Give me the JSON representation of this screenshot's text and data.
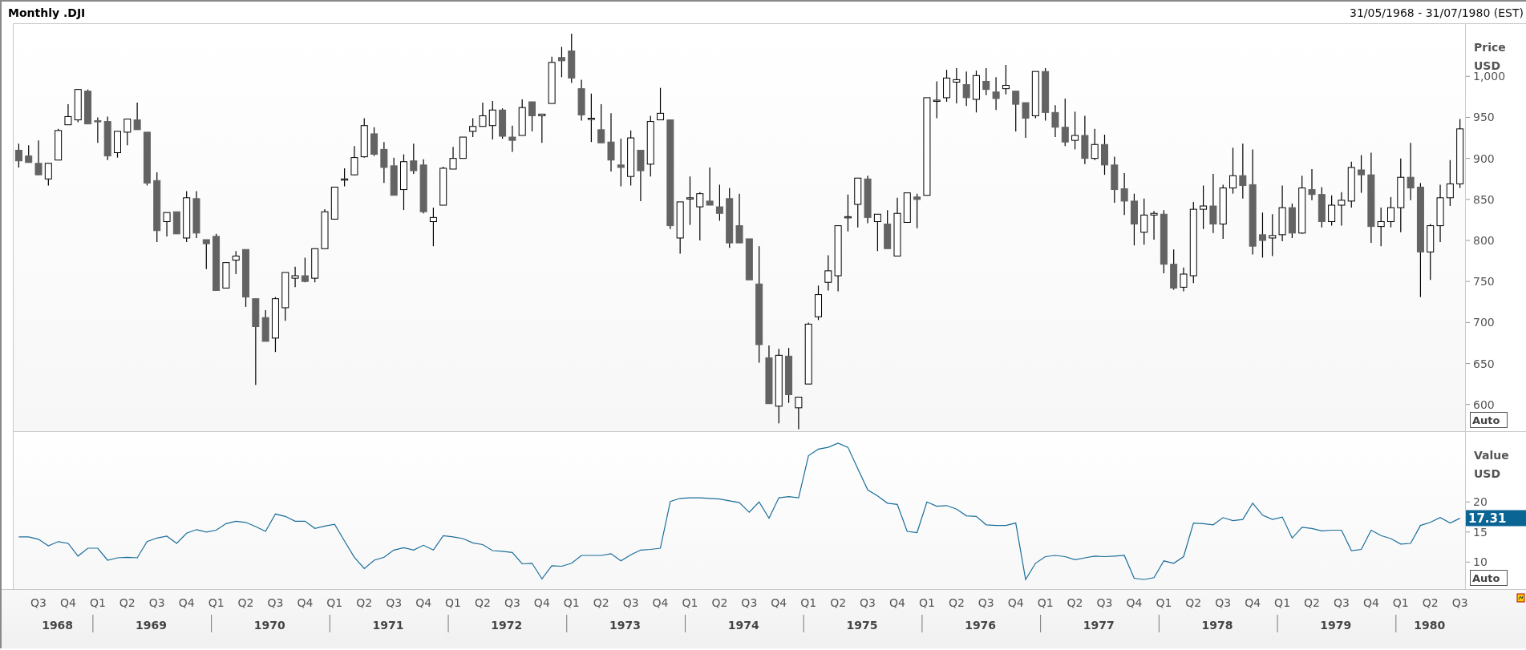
{
  "header": {
    "title": "Monthly .DJI",
    "date_range": "31/05/1968 - 31/07/1980 (EST)"
  },
  "price_panel": {
    "axis_title": "Price",
    "axis_unit": "USD",
    "scale_button": "Auto",
    "chart_data": {
      "type": "candlestick",
      "ylim": [
        567.5,
        1063.8
      ],
      "yticks": [
        {
          "value": 600,
          "label": "600"
        },
        {
          "value": 650,
          "label": "650"
        },
        {
          "value": 700,
          "label": "700"
        },
        {
          "value": 750,
          "label": "750"
        },
        {
          "value": 800,
          "label": "800"
        },
        {
          "value": 850,
          "label": "850"
        },
        {
          "value": 900,
          "label": "900"
        },
        {
          "value": 950,
          "label": "950"
        },
        {
          "value": 1000,
          "label": "1,000"
        }
      ],
      "ohlc": [
        [
          910,
          918,
          889,
          897
        ],
        [
          903,
          916,
          895,
          895
        ],
        [
          894,
          922,
          880,
          880
        ],
        [
          875,
          894,
          867,
          894
        ],
        [
          898,
          936,
          898,
          934
        ],
        [
          941,
          966,
          941,
          951
        ],
        [
          947,
          984,
          944,
          984
        ],
        [
          982,
          984,
          942,
          942
        ],
        [
          946,
          950,
          919,
          945
        ],
        [
          945,
          951,
          898,
          903
        ],
        [
          907,
          933,
          901,
          933
        ],
        [
          932,
          948,
          916,
          948
        ],
        [
          947,
          968,
          935,
          935
        ],
        [
          932,
          932,
          867,
          870
        ],
        [
          873,
          883,
          798,
          812
        ],
        [
          823,
          834,
          805,
          834
        ],
        [
          835,
          835,
          808,
          808
        ],
        [
          803,
          860,
          798,
          852
        ],
        [
          851,
          860,
          803,
          809
        ],
        [
          801,
          801,
          765,
          796
        ],
        [
          805,
          808,
          739,
          739
        ],
        [
          742,
          773,
          742,
          773
        ],
        [
          776,
          787,
          759,
          781
        ],
        [
          789,
          789,
          719,
          731
        ],
        [
          729,
          729,
          624,
          695
        ],
        [
          706,
          715,
          677,
          677
        ],
        [
          681,
          731,
          664,
          729
        ],
        [
          718,
          761,
          702,
          761
        ],
        [
          754,
          768,
          743,
          757
        ],
        [
          757,
          779,
          749,
          750
        ],
        [
          754,
          790,
          749,
          790
        ],
        [
          790,
          838,
          790,
          835
        ],
        [
          826,
          865,
          826,
          865
        ],
        [
          875,
          888,
          866,
          875
        ],
        [
          880,
          915,
          880,
          901
        ],
        [
          902,
          949,
          901,
          940
        ],
        [
          930,
          938,
          903,
          905
        ],
        [
          911,
          920,
          870,
          889
        ],
        [
          891,
          901,
          855,
          855
        ],
        [
          862,
          905,
          837,
          896
        ],
        [
          897,
          918,
          881,
          885
        ],
        [
          892,
          899,
          833,
          835
        ],
        [
          823,
          840,
          793,
          828
        ],
        [
          843,
          890,
          843,
          888
        ],
        [
          887,
          914,
          887,
          900
        ],
        [
          900,
          926,
          900,
          926
        ],
        [
          933,
          949,
          926,
          939
        ],
        [
          939,
          968,
          939,
          952
        ],
        [
          940,
          970,
          923,
          959
        ],
        [
          959,
          961,
          924,
          927
        ],
        [
          926,
          940,
          908,
          922
        ],
        [
          928,
          972,
          928,
          962
        ],
        [
          969,
          969,
          933,
          952
        ],
        [
          952,
          954,
          919,
          954
        ],
        [
          967,
          1024,
          967,
          1017
        ],
        [
          1023,
          1036,
          999,
          1019
        ],
        [
          1031,
          1052,
          992,
          998
        ],
        [
          985,
          996,
          946,
          953
        ],
        [
          949,
          979,
          920,
          949
        ],
        [
          935,
          966,
          919,
          919
        ],
        [
          920,
          955,
          884,
          898
        ],
        [
          892,
          924,
          866,
          889
        ],
        [
          878,
          934,
          867,
          925
        ],
        [
          910,
          910,
          848,
          885
        ],
        [
          893,
          952,
          878,
          945
        ],
        [
          947,
          986,
          947,
          955
        ],
        [
          947,
          947,
          814,
          818
        ],
        [
          803,
          847,
          784,
          847
        ],
        [
          852,
          878,
          819,
          852
        ],
        [
          841,
          859,
          800,
          857
        ],
        [
          848,
          889,
          843,
          843
        ],
        [
          841,
          868,
          824,
          833
        ],
        [
          851,
          864,
          791,
          797
        ],
        [
          818,
          857,
          797,
          797
        ],
        [
          802,
          802,
          752,
          752
        ],
        [
          747,
          793,
          651,
          673
        ],
        [
          657,
          672,
          601,
          601
        ],
        [
          598,
          668,
          577,
          660
        ],
        [
          659,
          669,
          602,
          612
        ],
        [
          596,
          609,
          570,
          609
        ],
        [
          625,
          700,
          625,
          698
        ],
        [
          707,
          745,
          703,
          734
        ],
        [
          749,
          782,
          739,
          763
        ],
        [
          757,
          818,
          738,
          818
        ],
        [
          829,
          856,
          811,
          829
        ],
        [
          844,
          876,
          816,
          876
        ],
        [
          875,
          879,
          821,
          828
        ],
        [
          823,
          832,
          787,
          832
        ],
        [
          820,
          837,
          790,
          790
        ],
        [
          781,
          852,
          781,
          833
        ],
        [
          822,
          858,
          822,
          858
        ],
        [
          853,
          857,
          815,
          850
        ],
        [
          855,
          974,
          855,
          974
        ],
        [
          971,
          994,
          949,
          971
        ],
        [
          974,
          1008,
          969,
          998
        ],
        [
          993,
          1010,
          967,
          996
        ],
        [
          990,
          1006,
          964,
          974
        ],
        [
          972,
          1007,
          956,
          1001
        ],
        [
          994,
          1010,
          977,
          984
        ],
        [
          981,
          999,
          959,
          973
        ],
        [
          985,
          1014,
          978,
          989
        ],
        [
          982,
          982,
          933,
          966
        ],
        [
          968,
          968,
          925,
          949
        ],
        [
          952,
          1006,
          949,
          1006
        ],
        [
          1006,
          1010,
          946,
          956
        ],
        [
          956,
          965,
          926,
          938
        ],
        [
          938,
          973,
          915,
          920
        ],
        [
          922,
          957,
          911,
          928
        ],
        [
          928,
          952,
          893,
          900
        ],
        [
          900,
          936,
          898,
          917
        ],
        [
          917,
          929,
          880,
          892
        ],
        [
          892,
          902,
          846,
          862
        ],
        [
          863,
          882,
          831,
          848
        ],
        [
          848,
          857,
          794,
          820
        ],
        [
          810,
          851,
          795,
          831
        ],
        [
          831,
          836,
          801,
          833
        ],
        [
          832,
          837,
          760,
          771
        ],
        [
          771,
          789,
          740,
          742
        ],
        [
          743,
          767,
          738,
          759
        ],
        [
          757,
          847,
          748,
          838
        ],
        [
          838,
          867,
          814,
          842
        ],
        [
          842,
          881,
          809,
          820
        ],
        [
          820,
          868,
          802,
          864
        ],
        [
          864,
          913,
          857,
          879
        ],
        [
          879,
          918,
          851,
          867
        ],
        [
          868,
          911,
          783,
          793
        ],
        [
          807,
          834,
          779,
          800
        ],
        [
          803,
          832,
          781,
          806
        ],
        [
          807,
          867,
          799,
          840
        ],
        [
          840,
          845,
          803,
          809
        ],
        [
          809,
          879,
          808,
          864
        ],
        [
          862,
          887,
          849,
          856
        ],
        [
          856,
          865,
          816,
          823
        ],
        [
          823,
          855,
          818,
          843
        ],
        [
          843,
          859,
          818,
          849
        ],
        [
          848,
          896,
          840,
          889
        ],
        [
          886,
          904,
          858,
          880
        ],
        [
          880,
          907,
          797,
          817
        ],
        [
          817,
          840,
          793,
          823
        ],
        [
          823,
          853,
          816,
          840
        ],
        [
          840,
          900,
          810,
          877
        ],
        [
          877,
          919,
          849,
          864
        ],
        [
          865,
          870,
          731,
          786
        ],
        [
          786,
          820,
          752,
          818
        ],
        [
          818,
          868,
          798,
          852
        ],
        [
          852,
          898,
          842,
          869
        ],
        [
          869,
          948,
          864,
          936
        ]
      ]
    }
  },
  "value_panel": {
    "axis_title": "Value",
    "axis_unit": "USD",
    "reading": "17.31",
    "scale_button": "Auto",
    "chart_data": {
      "type": "line",
      "ylim": [
        5.5,
        31.65
      ],
      "yticks": [
        {
          "value": 10,
          "label": "10"
        },
        {
          "value": 15,
          "label": "15"
        },
        {
          "value": 20,
          "label": "20"
        }
      ],
      "series": [
        {
          "color": "#1a6e9a",
          "values": [
            14.2,
            14.2,
            13.8,
            12.7,
            13.4,
            13.1,
            11.0,
            12.3,
            12.3,
            10.3,
            10.7,
            10.8,
            10.7,
            13.4,
            14.0,
            14.3,
            13.1,
            14.8,
            15.4,
            15.0,
            15.3,
            16.4,
            16.8,
            16.6,
            15.9,
            15.1,
            18.0,
            17.6,
            16.8,
            16.8,
            15.6,
            16.0,
            16.3,
            13.5,
            10.8,
            8.9,
            10.3,
            10.8,
            12.0,
            12.4,
            12.0,
            12.8,
            12.0,
            14.4,
            14.2,
            13.9,
            13.2,
            12.9,
            11.9,
            11.8,
            11.6,
            9.7,
            9.8,
            7.2,
            9.4,
            9.3,
            9.8,
            11.1,
            11.1,
            11.1,
            11.4,
            10.2,
            11.2,
            12.0,
            12.1,
            12.3,
            20.1,
            20.6,
            20.7,
            20.7,
            20.6,
            20.5,
            20.2,
            19.9,
            18.3,
            20.0,
            17.3,
            20.7,
            20.9,
            20.7,
            27.7,
            28.8,
            29.1,
            29.8,
            29.1,
            25.5,
            22.0,
            21.0,
            19.8,
            19.6,
            15.1,
            14.9,
            20.0,
            19.3,
            19.4,
            18.8,
            17.7,
            17.6,
            16.2,
            16.1,
            16.1,
            16.5,
            7.1,
            9.8,
            10.9,
            11.1,
            10.9,
            10.4,
            10.7,
            11.0,
            10.9,
            11.0,
            11.1,
            7.3,
            7.1,
            7.4,
            10.2,
            9.8,
            10.9,
            16.5,
            16.4,
            16.2,
            17.4,
            16.9,
            17.1,
            19.8,
            17.8,
            17.1,
            17.5,
            14.0,
            15.8,
            15.6,
            15.2,
            15.3,
            15.3,
            11.9,
            12.1,
            15.3,
            14.4,
            13.9,
            13.0,
            13.1,
            16.1,
            16.6,
            17.4,
            16.5,
            17.3
          ]
        }
      ]
    }
  },
  "time_axis": {
    "quarters": [
      "Q3",
      "Q4",
      "Q1",
      "Q2",
      "Q3",
      "Q4",
      "Q1",
      "Q2",
      "Q3",
      "Q4",
      "Q1",
      "Q2",
      "Q3",
      "Q4",
      "Q1",
      "Q2",
      "Q3",
      "Q4",
      "Q1",
      "Q2",
      "Q3",
      "Q4",
      "Q1",
      "Q2",
      "Q3",
      "Q4",
      "Q1",
      "Q2",
      "Q3",
      "Q4",
      "Q1",
      "Q2",
      "Q3",
      "Q4",
      "Q1",
      "Q2",
      "Q3",
      "Q4",
      "Q1",
      "Q2",
      "Q3",
      "Q4",
      "Q1",
      "Q2",
      "Q3",
      "Q4",
      "Q1",
      "Q2",
      "Q3"
    ],
    "years": [
      "1968",
      "1969",
      "1970",
      "1971",
      "1972",
      "1973",
      "1974",
      "1975",
      "1976",
      "1977",
      "1978",
      "1979",
      "1980"
    ]
  }
}
